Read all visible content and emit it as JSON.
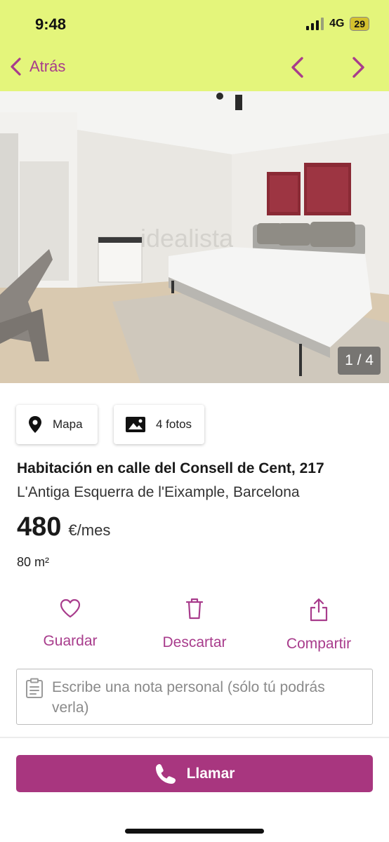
{
  "status_bar": {
    "time": "9:48",
    "network": "4G",
    "battery": "29"
  },
  "nav": {
    "back_label": "Atrás",
    "back_icon": "chevron-left-icon",
    "prev_icon": "chevron-left-icon",
    "next_icon": "chevron-right-icon"
  },
  "gallery": {
    "counter": "1 / 4",
    "watermark": "idealista"
  },
  "chips": [
    {
      "label": "Mapa",
      "icon": "map-pin-icon"
    },
    {
      "label": "4 fotos",
      "icon": "image-icon"
    }
  ],
  "listing": {
    "title": "Habitación en calle del Consell de Cent, 217",
    "location": "L'Antiga Esquerra de l'Eixample, Barcelona",
    "price": "480",
    "price_unit": "€/mes",
    "area": "80 m²"
  },
  "actions": [
    {
      "label": "Guardar",
      "icon": "heart-icon"
    },
    {
      "label": "Descartar",
      "icon": "trash-icon"
    },
    {
      "label": "Compartir",
      "icon": "share-icon"
    }
  ],
  "note": {
    "placeholder": "Escribe una nota personal (sólo tú podrás verla)"
  },
  "call": {
    "label": "Llamar",
    "icon": "phone-icon"
  },
  "colors": {
    "header_bg": "#e4f57b",
    "accent": "#a83c8c",
    "button_bg": "#a8367f"
  }
}
